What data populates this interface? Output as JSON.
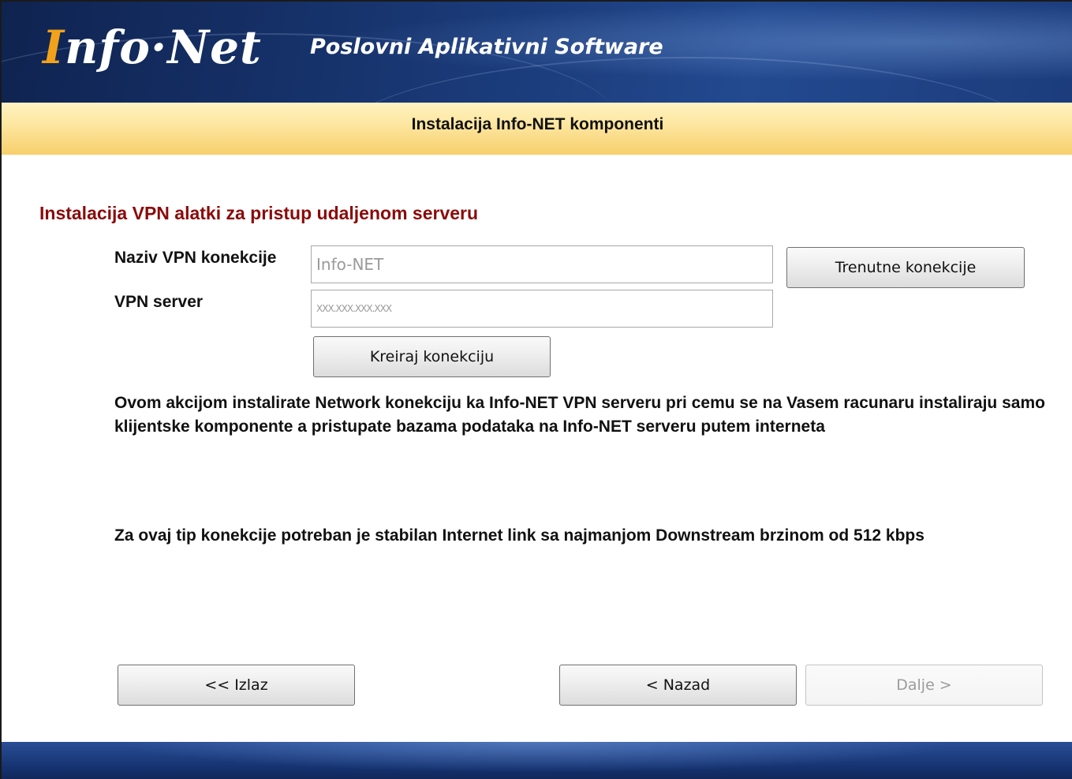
{
  "header": {
    "logo_initial": "I",
    "logo_rest": "nfo·Net",
    "tagline": "Poslovni Aplikativni Software"
  },
  "subtitle": "Instalacija Info-NET komponenti",
  "section_title": "Instalacija VPN alatki za pristup udaljenom serveru",
  "form": {
    "vpn_name_label": "Naziv VPN konekcije",
    "vpn_name_value": "Info-NET",
    "vpn_server_label": "VPN server",
    "vpn_server_value": "XXX.XXX.XXX.XXX",
    "current_connections_button": "Trenutne konekcije",
    "create_connection_button": "Kreiraj  konekciju"
  },
  "description": "Ovom akcijom instalirate Network konekciju ka Info-NET VPN serveru pri cemu se na Vasem racunaru instaliraju samo klijentske komponente a pristupate bazama podataka na Info-NET serveru putem interneta",
  "requirement": "Za ovaj tip konekcije potreban je stabilan Internet link sa najmanjom Downstream brzinom od 512 kbps",
  "nav": {
    "exit_button": "<< Izlaz",
    "back_button": "< Nazad",
    "next_button": "Dalje >",
    "next_enabled": false
  },
  "colors": {
    "section_title": "#8b0a0a",
    "logo_accent": "#f2a21a",
    "header_bg": "#1a3a78"
  }
}
